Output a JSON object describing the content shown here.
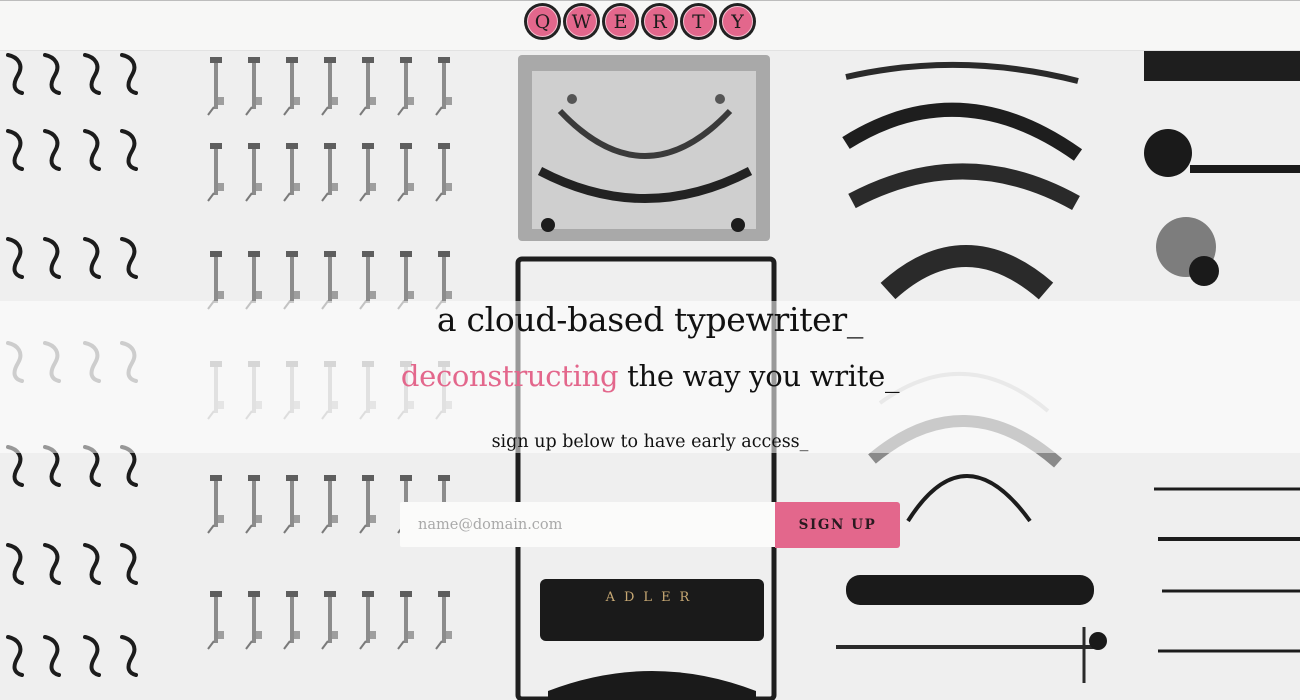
{
  "brand": {
    "logo_letters": [
      "Q",
      "W",
      "E",
      "R",
      "T",
      "Y"
    ],
    "logo_key_color": "#e3678c"
  },
  "hero": {
    "title": "a cloud-based typewriter_",
    "subtitle_accent": "deconstructing",
    "subtitle_rest": " the way you write_",
    "cta_text": "sign up below to have early access_",
    "accent_color": "#e3678c"
  },
  "form": {
    "email_placeholder": "name@domain.com",
    "submit_label": "SIGN UP"
  },
  "background": {
    "icon": "disassembled-typewriter-photo",
    "stamped_text": "ADLER"
  }
}
